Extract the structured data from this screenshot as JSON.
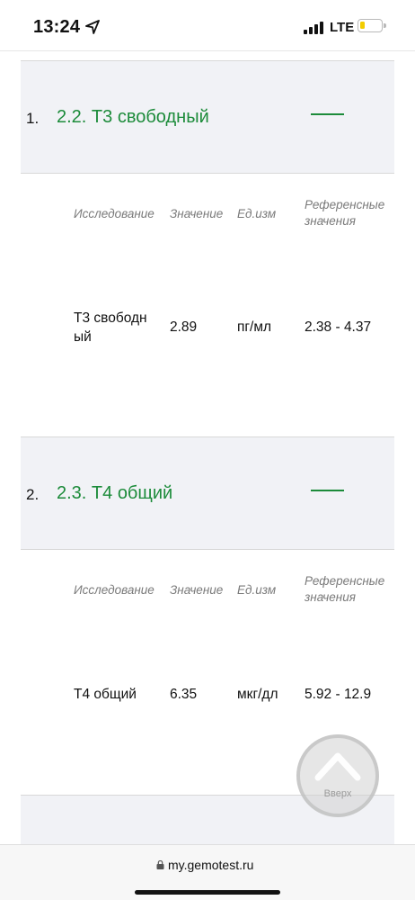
{
  "status_bar": {
    "time": "13:24",
    "network": "LTE",
    "battery_color": "#f2cc00"
  },
  "tests": [
    {
      "number": "1.",
      "title": "2.2. Т3 свободный",
      "columns": {
        "study": "Исследование",
        "value": "Значение",
        "unit": "Ед.изм",
        "reference_line1": "Референсные",
        "reference_line2": "значения"
      },
      "row": {
        "study_line1": "Т3 свободн",
        "study_line2": "ый",
        "value": "2.89",
        "unit": "пг/мл",
        "reference": "2.38 - 4.37"
      }
    },
    {
      "number": "2.",
      "title": "2.3. Т4 общий",
      "columns": {
        "study": "Исследование",
        "value": "Значение",
        "unit": "Ед.изм",
        "reference_line1": "Референсные",
        "reference_line2": "значения"
      },
      "row": {
        "study_line1": "Т4 общий",
        "study_line2": "",
        "value": "6.35",
        "unit": "мкг/дл",
        "reference": "5.92 - 12.9"
      }
    }
  ],
  "scroll_top": {
    "label": "Вверх",
    "icon": "chevron-up-icon"
  },
  "browser": {
    "url": "my.gemotest.ru",
    "lock_icon": "lock-icon"
  },
  "accent_color": "#1c8b3a"
}
